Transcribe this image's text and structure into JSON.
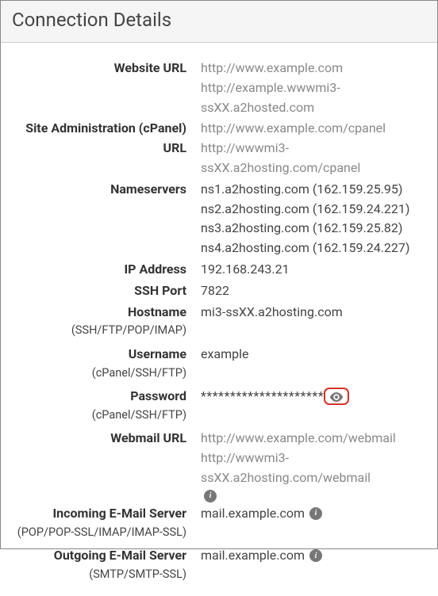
{
  "panel": {
    "title": "Connection Details"
  },
  "rows": {
    "website_url": {
      "label": "Website URL",
      "values": [
        "http://www.example.com",
        "http://example.wwwmi3-ssXX.a2hosted.com"
      ]
    },
    "admin_url": {
      "label": "Site Administration (cPanel) URL",
      "values": [
        "http://www.example.com/cpanel",
        "http://wwwmi3-ssXX.a2hosting.com/cpanel"
      ]
    },
    "nameservers": {
      "label": "Nameservers",
      "values": [
        "ns1.a2hosting.com (162.159.25.95)",
        "ns2.a2hosting.com (162.159.24.221)",
        "ns3.a2hosting.com (162.159.25.82)",
        "ns4.a2hosting.com (162.159.24.227)"
      ]
    },
    "ip": {
      "label": "IP Address",
      "value": "192.168.243.21"
    },
    "ssh_port": {
      "label": "SSH Port",
      "value": "7822"
    },
    "hostname": {
      "label": "Hostname",
      "sub": "(SSH/FTP/POP/IMAP)",
      "value": "mi3-ssXX.a2hosting.com"
    },
    "username": {
      "label": "Username",
      "sub": "(cPanel/SSH/FTP)",
      "value": "example"
    },
    "password": {
      "label": "Password",
      "sub": "(cPanel/SSH/FTP)",
      "value": "*********************"
    },
    "webmail": {
      "label": "Webmail URL",
      "values": [
        "http://www.example.com/webmail",
        "http://wwwmi3-ssXX.a2hosting.com/webmail"
      ]
    },
    "incoming": {
      "label": "Incoming E-Mail Server",
      "sub": "(POP/POP-SSL/IMAP/IMAP-SSL)",
      "value": "mail.example.com"
    },
    "outgoing": {
      "label": "Outgoing E-Mail Server",
      "sub": "(SMTP/SMTP-SSL)",
      "value": "mail.example.com"
    }
  }
}
